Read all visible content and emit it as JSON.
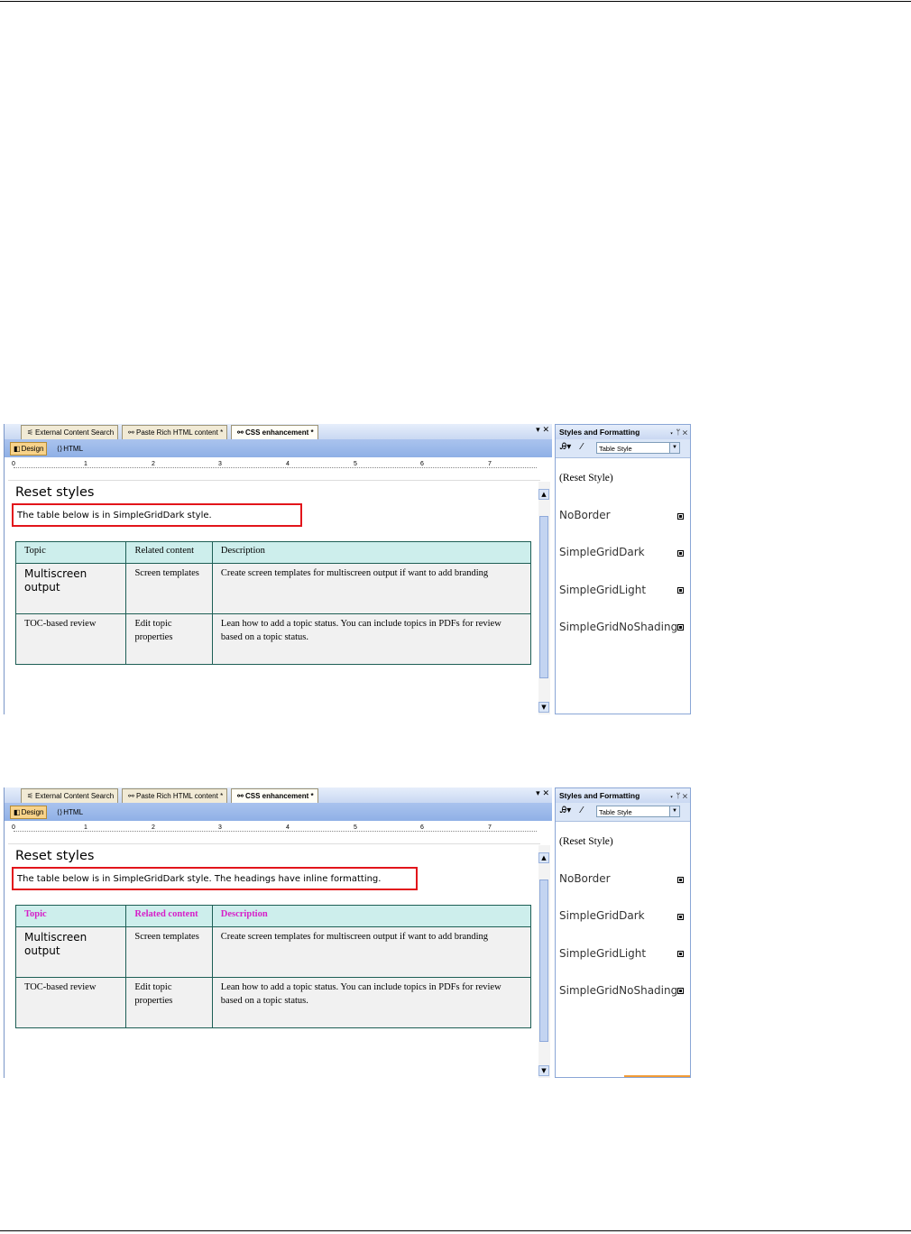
{
  "screenshots": [
    {
      "tabs": [
        {
          "icon": "search-doc-icon",
          "label": "External Content Search"
        },
        {
          "icon": "paste-icon",
          "label": "Paste Rich HTML content *"
        },
        {
          "icon": "css-icon",
          "label": "CSS enhancement *"
        }
      ],
      "tab_controls": "▾ ✕",
      "toolbar": {
        "design_label": "Design",
        "html_label": "HTML"
      },
      "ruler_numbers": [
        "0",
        "1",
        "2",
        "3",
        "4",
        "5",
        "6",
        "7"
      ],
      "document": {
        "title": "Reset styles",
        "note": "The table below is in SimpleGridDark style.",
        "headers": [
          "Topic",
          "Related content",
          "Description"
        ],
        "rows": [
          [
            "Multiscreen output",
            "Screen templates",
            "Create screen templates for multiscreen output if want to add branding"
          ],
          [
            "TOC-based review",
            "Edit topic properties",
            "Lean how to add a topic status. You can include topics in PDFs for review based on a topic status."
          ]
        ]
      },
      "panel": {
        "title": "Styles and Formatting",
        "controls": "▾ ᛘ ✕",
        "select_value": "Table Style",
        "styles": [
          "(Reset Style)",
          "NoBorder",
          "SimpleGridDark",
          "SimpleGridLight",
          "SimpleGridNoShading"
        ]
      }
    },
    {
      "tabs": [
        {
          "icon": "search-doc-icon",
          "label": "External Content Search"
        },
        {
          "icon": "paste-icon",
          "label": "Paste Rich HTML content *"
        },
        {
          "icon": "css-icon",
          "label": "CSS enhancement *"
        }
      ],
      "tab_controls": "▾ ✕",
      "toolbar": {
        "design_label": "Design",
        "html_label": "HTML"
      },
      "ruler_numbers": [
        "0",
        "1",
        "2",
        "3",
        "4",
        "5",
        "6",
        "7"
      ],
      "document": {
        "title": "Reset styles",
        "note": "The table below is in SimpleGridDark style. The headings have inline formatting.",
        "headers": [
          "Topic",
          "Related content",
          "Description"
        ],
        "header_color": "#d61ec9",
        "rows": [
          [
            "Multiscreen output",
            "Screen templates",
            "Create screen templates for multiscreen output if want to add branding"
          ],
          [
            "TOC-based review",
            "Edit topic properties",
            "Lean how to add a topic status. You can include topics in PDFs for review based on a topic status."
          ]
        ]
      },
      "panel": {
        "title": "Styles and Formatting",
        "controls": "▾ ᛘ ✕",
        "select_value": "Table Style",
        "styles": [
          "(Reset Style)",
          "NoBorder",
          "SimpleGridDark",
          "SimpleGridLight",
          "SimpleGridNoShading"
        ]
      }
    }
  ],
  "colors": {
    "note_border": "#e2151b",
    "table_border": "#1d5e55",
    "header_bg": "#cdeeec",
    "cell_bg": "#f1f1f1"
  }
}
